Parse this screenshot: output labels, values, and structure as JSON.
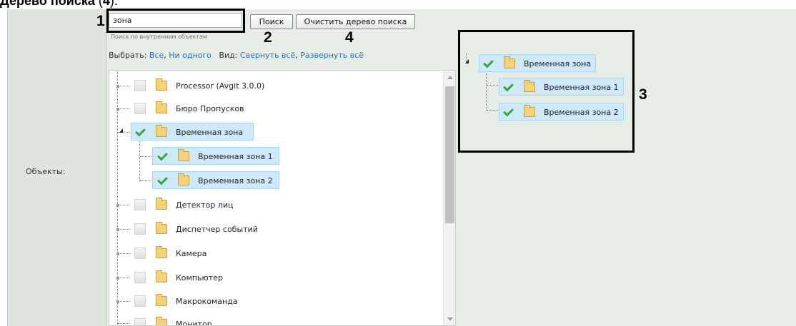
{
  "heading": {
    "bold": "Дерево поиска",
    "paren_open": " (",
    "num": "4",
    "paren_close": ")."
  },
  "form": {
    "row_label": "Объекты:"
  },
  "search": {
    "value": "зона",
    "hint": "Поиск по внутренним объектам"
  },
  "buttons": {
    "search": "Поиск",
    "clear": "Очистить дерево поиска"
  },
  "callouts": {
    "c1": "1",
    "c2": "2",
    "c3": "3",
    "c4": "4"
  },
  "select_row": {
    "select_label": "Выбрать:",
    "all": "Все",
    "none": "Ни одного",
    "view_label": "Вид:",
    "collapse_all": "Свернуть всё",
    "expand_all": "Развернуть всё"
  },
  "tree": {
    "items": [
      {
        "label": "Processor (Avgit 3.0.0)",
        "checked": false
      },
      {
        "label": "Бюро Пропусков",
        "checked": false
      },
      {
        "label": "Временная зона",
        "checked": true,
        "expanded": true,
        "highlighted": true
      },
      {
        "label": "Временная зона 1",
        "checked": true,
        "highlighted": true
      },
      {
        "label": "Временная зона 2",
        "checked": true,
        "highlighted": true
      },
      {
        "label": "Детектор лиц",
        "checked": false
      },
      {
        "label": "Диспетчер событий",
        "checked": false
      },
      {
        "label": "Камера",
        "checked": false
      },
      {
        "label": "Компьютер",
        "checked": false
      },
      {
        "label": "Макрокоманда",
        "checked": false
      },
      {
        "label": "Монитор",
        "checked": false
      }
    ]
  },
  "search_tree": {
    "items": [
      {
        "label": "Временная зона",
        "checked": true
      },
      {
        "label": "Временная зона 1",
        "checked": true
      },
      {
        "label": "Временная зона 2",
        "checked": true
      }
    ]
  },
  "icons": {
    "checkbox": "checkbox-icon",
    "folder": "folder-icon",
    "tree_toggle": "tree-toggle-icon",
    "scroll_up": "scroll-up-arrow-icon",
    "scroll_down": "scroll-down-arrow-icon"
  },
  "colors": {
    "panel_bg": "#dde5dd",
    "right_column_bg": "#e6ece6",
    "link": "#1e6fc9",
    "selected_highlight": "#cfe9fb",
    "check": "#39a83c"
  }
}
